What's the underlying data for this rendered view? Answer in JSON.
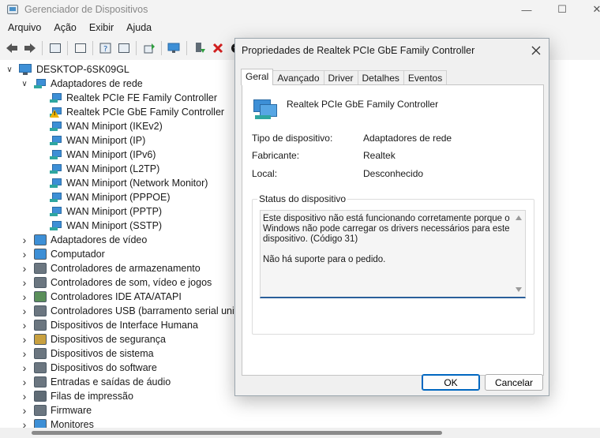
{
  "window": {
    "title": "Gerenciador de Dispositivos",
    "controls": [
      "—",
      "☐",
      "✕"
    ]
  },
  "menu": [
    "Arquivo",
    "Ação",
    "Exibir",
    "Ajuda"
  ],
  "tree": {
    "root": "DESKTOP-6SK09GL",
    "expanded_category": "Adaptadores de rede",
    "network_adapters": [
      "Realtek PCIe FE Family Controller",
      "Realtek PCIe GbE Family Controller",
      "WAN Miniport (IKEv2)",
      "WAN Miniport (IP)",
      "WAN Miniport (IPv6)",
      "WAN Miniport (L2TP)",
      "WAN Miniport (Network Monitor)",
      "WAN Miniport (PPPOE)",
      "WAN Miniport (PPTP)",
      "WAN Miniport (SSTP)"
    ],
    "categories": [
      "Adaptadores de vídeo",
      "Computador",
      "Controladores de armazenamento",
      "Controladores de som, vídeo e jogos",
      "Controladores IDE ATA/ATAPI",
      "Controladores USB (barramento serial univer",
      "Dispositivos de Interface Humana",
      "Dispositivos de segurança",
      "Dispositivos de sistema",
      "Dispositivos do software",
      "Entradas e saídas de áudio",
      "Filas de impressão",
      "Firmware",
      "Monitores"
    ]
  },
  "dialog": {
    "title": "Propriedades de Realtek PCIe GbE Family Controller",
    "tabs": [
      "Geral",
      "Avançado",
      "Driver",
      "Detalhes",
      "Eventos"
    ],
    "device_name": "Realtek PCIe GbE Family Controller",
    "props": {
      "type_label": "Tipo de dispositivo:",
      "type_value": "Adaptadores de rede",
      "maker_label": "Fabricante:",
      "maker_value": "Realtek",
      "location_label": "Local:",
      "location_value": "Desconhecido"
    },
    "status_group_label": "Status do dispositivo",
    "status_text": "Este dispositivo não está funcionando corretamente porque o\nWindows não pode carregar os drivers necessários para este\ndispositivo. (Código 31)\n\nNão há suporte para o pedido.",
    "ok_label": "OK",
    "cancel_label": "Cancelar"
  }
}
